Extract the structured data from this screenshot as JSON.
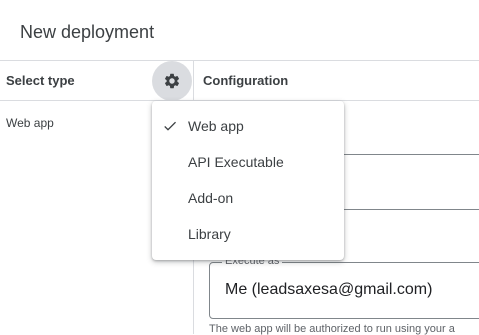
{
  "dialog": {
    "title": "New deployment"
  },
  "columns": {
    "select_type": "Select type",
    "configuration": "Configuration"
  },
  "sidebar": {
    "items": [
      {
        "label": "Web app"
      }
    ]
  },
  "type_menu": {
    "items": [
      {
        "label": "Web app",
        "selected": true
      },
      {
        "label": "API Executable",
        "selected": false
      },
      {
        "label": "Add-on",
        "selected": false
      },
      {
        "label": "Library",
        "selected": false
      }
    ]
  },
  "config": {
    "execute_as": {
      "label": "Execute as",
      "value": "Me (leadsaxesa@gmail.com)"
    },
    "help_text": "The web app will be authorized to run using your a"
  },
  "icons": {
    "settings": "gear-icon",
    "selected": "check-icon"
  },
  "colors": {
    "divider": "#dadce0",
    "gear_bg": "#dadce0",
    "text": "#3c4043"
  }
}
